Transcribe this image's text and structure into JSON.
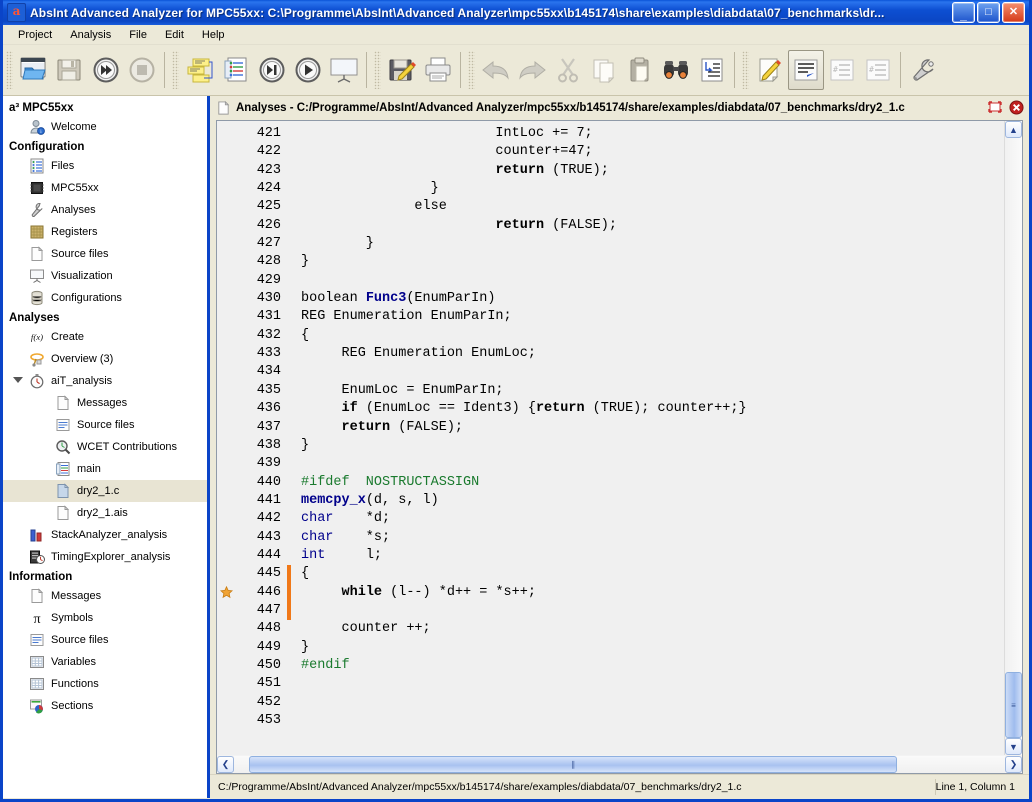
{
  "window": {
    "title": "AbsInt Advanced Analyzer for MPC55xx: C:\\Programme\\AbsInt\\Advanced Analyzer\\mpc55xx\\b145174\\share\\examples\\diabdata\\07_benchmarks\\dr...",
    "app_icon_letter": "a",
    "minimize_label": "_",
    "maximize_label": "□",
    "close_label": "✕",
    "accent_blue": "#0a44c8",
    "chrome_bg": "#ece9d8"
  },
  "menubar": {
    "items": [
      {
        "label": "Project"
      },
      {
        "label": "Analysis"
      },
      {
        "label": "File"
      },
      {
        "label": "Edit"
      },
      {
        "label": "Help"
      }
    ]
  },
  "toolbar": {
    "groups": [
      {
        "buttons": [
          {
            "name": "open-project-button",
            "icon": "open-folder-window-icon",
            "enabled": true
          },
          {
            "name": "save-project-button",
            "icon": "floppy-save-icon",
            "enabled": false
          },
          {
            "name": "run-all-button",
            "icon": "fast-forward-circle-icon",
            "enabled": true
          },
          {
            "name": "stop-button",
            "icon": "stop-circle-icon",
            "enabled": false
          }
        ]
      },
      {
        "buttons": [
          {
            "name": "notes-button",
            "icon": "sticky-notes-icon",
            "enabled": true
          },
          {
            "name": "report-button",
            "icon": "checklist-document-icon",
            "enabled": true
          },
          {
            "name": "run-step-button",
            "icon": "play-to-marker-circle-icon",
            "enabled": true
          },
          {
            "name": "run-analysis-button",
            "icon": "play-circle-icon",
            "enabled": true
          },
          {
            "name": "visualization-button",
            "icon": "presentation-board-icon",
            "enabled": true
          }
        ]
      },
      {
        "buttons": [
          {
            "name": "save-file-button",
            "icon": "floppy-pencil-icon",
            "enabled": true
          },
          {
            "name": "print-button",
            "icon": "printer-icon",
            "enabled": true
          }
        ]
      },
      {
        "buttons": [
          {
            "name": "undo-button",
            "icon": "undo-arrow-icon",
            "enabled": false
          },
          {
            "name": "redo-button",
            "icon": "redo-arrow-icon",
            "enabled": false
          },
          {
            "name": "cut-button",
            "icon": "scissors-icon",
            "enabled": false
          },
          {
            "name": "copy-button",
            "icon": "copy-pages-icon",
            "enabled": false
          },
          {
            "name": "paste-button",
            "icon": "clipboard-paste-icon",
            "enabled": false
          },
          {
            "name": "find-button",
            "icon": "binoculars-icon",
            "enabled": true
          },
          {
            "name": "goto-line-button",
            "icon": "goto-line-icon",
            "enabled": true
          }
        ]
      },
      {
        "buttons": [
          {
            "name": "edit-mode-button",
            "icon": "pencil-page-icon",
            "enabled": true
          },
          {
            "name": "wrap-lines-button",
            "icon": "lines-arrow-icon",
            "enabled": true,
            "pressed": true
          },
          {
            "name": "line-numbers-button",
            "icon": "hash-lines-icon",
            "enabled": false
          },
          {
            "name": "hide-numbers-button",
            "icon": "hash-lines-alt-icon",
            "enabled": false
          },
          {
            "name": "settings-button",
            "icon": "wrench-icon",
            "enabled": true
          }
        ]
      }
    ]
  },
  "sidebar": {
    "sections": [
      {
        "title": "a³ MPC55xx",
        "items": [
          {
            "label": "Welcome",
            "icon": "user-info-icon",
            "level": 1
          }
        ]
      },
      {
        "title": "Configuration",
        "items": [
          {
            "label": "Files",
            "icon": "files-list-icon",
            "level": 1
          },
          {
            "label": "MPC55xx",
            "icon": "cpu-chip-icon",
            "level": 1
          },
          {
            "label": "Analyses",
            "icon": "wrench-icon",
            "level": 1
          },
          {
            "label": "Registers",
            "icon": "registers-grid-icon",
            "level": 1
          },
          {
            "label": "Source files",
            "icon": "document-icon",
            "level": 1
          },
          {
            "label": "Visualization",
            "icon": "presentation-board-icon",
            "level": 1
          },
          {
            "label": "Configurations",
            "icon": "database-stack-icon",
            "level": 1
          }
        ]
      },
      {
        "title": "Analyses",
        "items": [
          {
            "label": "Create",
            "icon": "fx-function-icon",
            "level": 1
          },
          {
            "label": "Overview (3)",
            "icon": "overview-lasso-icon",
            "level": 1
          },
          {
            "label": "aiT_analysis",
            "icon": "stopwatch-icon",
            "level": 1,
            "expanded": true
          },
          {
            "label": "Messages",
            "icon": "document-icon",
            "level": 2
          },
          {
            "label": "Source files",
            "icon": "source-file-icon",
            "level": 2
          },
          {
            "label": "WCET Contributions",
            "icon": "wcet-magnifier-icon",
            "level": 2
          },
          {
            "label": "main",
            "icon": "checklist-document-icon",
            "level": 2
          },
          {
            "label": "dry2_1.c",
            "icon": "c-file-icon",
            "level": 2,
            "selected": true
          },
          {
            "label": "dry2_1.ais",
            "icon": "document-icon",
            "level": 2
          },
          {
            "label": "StackAnalyzer_analysis",
            "icon": "bar-chart-icon",
            "level": 1
          },
          {
            "label": "TimingExplorer_analysis",
            "icon": "timing-explorer-icon",
            "level": 1
          }
        ]
      },
      {
        "title": "Information",
        "items": [
          {
            "label": "Messages",
            "icon": "document-icon",
            "level": 1
          },
          {
            "label": "Symbols",
            "icon": "pi-symbol-icon",
            "level": 1
          },
          {
            "label": "Source files",
            "icon": "source-file-icon",
            "level": 1
          },
          {
            "label": "Variables",
            "icon": "table-grid-icon",
            "level": 1
          },
          {
            "label": "Functions",
            "icon": "table-grid-icon",
            "level": 1
          },
          {
            "label": "Sections",
            "icon": "sections-pie-icon",
            "level": 1
          }
        ]
      }
    ]
  },
  "document": {
    "tab_title": "Analyses - C:/Programme/AbsInt/Advanced Analyzer/mpc55xx/b145174/share/examples/diabdata/07_benchmarks/dry2_1.c",
    "undock_label": "undock-icon",
    "close_label": "close-icon"
  },
  "editor": {
    "first_line": 421,
    "lines": [
      {
        "no": "421",
        "marker": "",
        "highlight": false,
        "tokens": [
          {
            "t": "                        IntLoc += 7;",
            "c": ""
          }
        ]
      },
      {
        "no": "422",
        "marker": "",
        "highlight": false,
        "tokens": [
          {
            "t": "                        counter+=47;",
            "c": ""
          }
        ]
      },
      {
        "no": "423",
        "marker": "",
        "highlight": false,
        "tokens": [
          {
            "t": "                        ",
            "c": ""
          },
          {
            "t": "return",
            "c": "k"
          },
          {
            "t": " (TRUE);",
            "c": ""
          }
        ]
      },
      {
        "no": "424",
        "marker": "",
        "highlight": false,
        "tokens": [
          {
            "t": "                }",
            "c": ""
          }
        ]
      },
      {
        "no": "425",
        "marker": "",
        "highlight": false,
        "tokens": [
          {
            "t": "              else",
            "c": ""
          }
        ]
      },
      {
        "no": "426",
        "marker": "",
        "highlight": false,
        "tokens": [
          {
            "t": "                        ",
            "c": ""
          },
          {
            "t": "return",
            "c": "k"
          },
          {
            "t": " (FALSE);",
            "c": ""
          }
        ]
      },
      {
        "no": "427",
        "marker": "",
        "highlight": false,
        "tokens": [
          {
            "t": "        }",
            "c": ""
          }
        ]
      },
      {
        "no": "428",
        "marker": "",
        "highlight": false,
        "tokens": [
          {
            "t": "}",
            "c": ""
          }
        ]
      },
      {
        "no": "429",
        "marker": "",
        "highlight": false,
        "tokens": [
          {
            "t": "",
            "c": ""
          }
        ]
      },
      {
        "no": "430",
        "marker": "",
        "highlight": false,
        "tokens": [
          {
            "t": "boolean ",
            "c": ""
          },
          {
            "t": "Func3",
            "c": "fn"
          },
          {
            "t": "(EnumParIn)",
            "c": ""
          }
        ]
      },
      {
        "no": "431",
        "marker": "",
        "highlight": false,
        "tokens": [
          {
            "t": "REG Enumeration EnumParIn;",
            "c": ""
          }
        ]
      },
      {
        "no": "432",
        "marker": "",
        "highlight": false,
        "tokens": [
          {
            "t": "{",
            "c": ""
          }
        ]
      },
      {
        "no": "433",
        "marker": "",
        "highlight": false,
        "tokens": [
          {
            "t": "     REG Enumeration EnumLoc;",
            "c": ""
          }
        ]
      },
      {
        "no": "434",
        "marker": "",
        "highlight": false,
        "tokens": [
          {
            "t": "",
            "c": ""
          }
        ]
      },
      {
        "no": "435",
        "marker": "",
        "highlight": false,
        "tokens": [
          {
            "t": "     EnumLoc = EnumParIn;",
            "c": ""
          }
        ]
      },
      {
        "no": "436",
        "marker": "",
        "highlight": false,
        "tokens": [
          {
            "t": "     ",
            "c": ""
          },
          {
            "t": "if",
            "c": "k"
          },
          {
            "t": " (EnumLoc == Ident3) {",
            "c": ""
          },
          {
            "t": "return",
            "c": "k"
          },
          {
            "t": " (TRUE); counter++;}",
            "c": ""
          }
        ]
      },
      {
        "no": "437",
        "marker": "",
        "highlight": false,
        "tokens": [
          {
            "t": "     ",
            "c": ""
          },
          {
            "t": "return",
            "c": "k"
          },
          {
            "t": " (FALSE);",
            "c": ""
          }
        ]
      },
      {
        "no": "438",
        "marker": "",
        "highlight": false,
        "tokens": [
          {
            "t": "}",
            "c": ""
          }
        ]
      },
      {
        "no": "439",
        "marker": "",
        "highlight": false,
        "tokens": [
          {
            "t": "",
            "c": ""
          }
        ]
      },
      {
        "no": "440",
        "marker": "",
        "highlight": false,
        "tokens": [
          {
            "t": "#ifdef  NOSTRUCTASSIGN",
            "c": "pp"
          }
        ]
      },
      {
        "no": "441",
        "marker": "",
        "highlight": false,
        "tokens": [
          {
            "t": "memcpy_x",
            "c": "fn"
          },
          {
            "t": "(d, s, l)",
            "c": ""
          }
        ]
      },
      {
        "no": "442",
        "marker": "",
        "highlight": false,
        "tokens": [
          {
            "t": "char",
            "c": "ty"
          },
          {
            "t": "    *d;",
            "c": ""
          }
        ]
      },
      {
        "no": "443",
        "marker": "",
        "highlight": false,
        "tokens": [
          {
            "t": "char",
            "c": "ty"
          },
          {
            "t": "    *s;",
            "c": ""
          }
        ]
      },
      {
        "no": "444",
        "marker": "",
        "highlight": false,
        "tokens": [
          {
            "t": "int",
            "c": "ty"
          },
          {
            "t": "     l;",
            "c": ""
          }
        ]
      },
      {
        "no": "445",
        "marker": "",
        "highlight": true,
        "tokens": [
          {
            "t": "{",
            "c": ""
          }
        ]
      },
      {
        "no": "446",
        "marker": "bookmark-star-icon",
        "highlight": true,
        "tokens": [
          {
            "t": "     ",
            "c": ""
          },
          {
            "t": "while",
            "c": "k"
          },
          {
            "t": " (l--) *d++ = *s++;",
            "c": ""
          }
        ]
      },
      {
        "no": "447",
        "marker": "",
        "highlight": true,
        "tokens": [
          {
            "t": "",
            "c": ""
          }
        ]
      },
      {
        "no": "448",
        "marker": "",
        "highlight": false,
        "tokens": [
          {
            "t": "     counter ++;",
            "c": ""
          }
        ]
      },
      {
        "no": "449",
        "marker": "",
        "highlight": false,
        "tokens": [
          {
            "t": "}",
            "c": ""
          }
        ]
      },
      {
        "no": "450",
        "marker": "",
        "highlight": false,
        "tokens": [
          {
            "t": "#endif",
            "c": "pp"
          }
        ]
      },
      {
        "no": "451",
        "marker": "",
        "highlight": false,
        "tokens": [
          {
            "t": "",
            "c": ""
          }
        ]
      },
      {
        "no": "452",
        "marker": "",
        "highlight": false,
        "tokens": [
          {
            "t": "",
            "c": ""
          }
        ]
      },
      {
        "no": "453",
        "marker": "",
        "highlight": false,
        "tokens": [
          {
            "t": "",
            "c": ""
          }
        ]
      }
    ],
    "scroll": {
      "vertical_up_label": "▲",
      "vertical_down_label": "▼",
      "horizontal_left_label": "❮",
      "horizontal_right_label": "❯",
      "v_thumb_top_pct": 89,
      "v_thumb_height_pct": 11,
      "h_thumb_left_pct": 2,
      "h_thumb_width_pct": 84
    },
    "highlight_color": "#f07818"
  },
  "statusbar": {
    "path": "C:/Programme/AbsInt/Advanced Analyzer/mpc55xx/b145174/share/examples/diabdata/07_benchmarks/dry2_1.c",
    "position": "Line 1, Column 1"
  }
}
